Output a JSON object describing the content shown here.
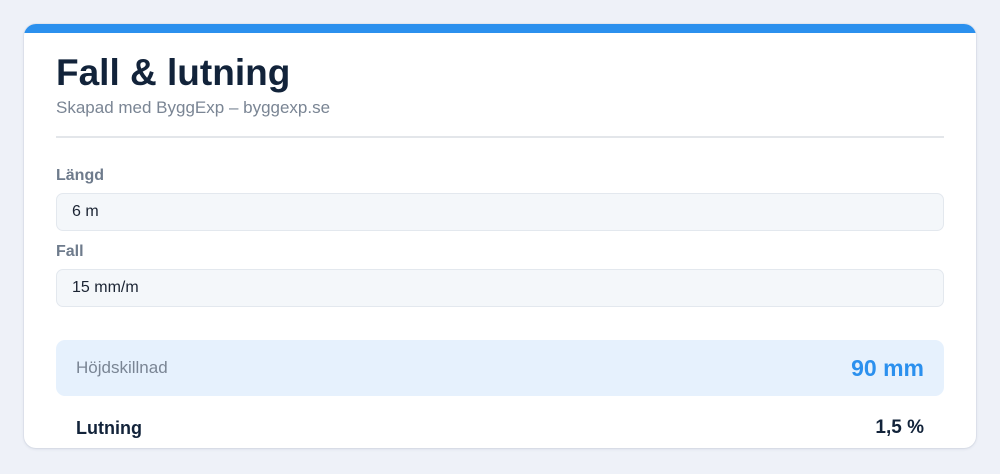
{
  "header": {
    "title": "Fall & lutning",
    "subtitle": "Skapad med ByggExp – byggexp.se"
  },
  "fields": {
    "length": {
      "label": "Längd",
      "value": "6 m"
    },
    "fall": {
      "label": "Fall",
      "value": "15 mm/m"
    }
  },
  "results": {
    "height_diff": {
      "label": "Höjdskillnad",
      "value": "90 mm"
    },
    "slope": {
      "label": "Lutning",
      "value": "1,5 %"
    }
  },
  "colors": {
    "accent": "#2b90ee",
    "background": "#eef1f8",
    "card": "#ffffff",
    "result_highlight": "#e6f1fd",
    "heading_text": "#12233a",
    "muted_text": "#7a8594"
  }
}
